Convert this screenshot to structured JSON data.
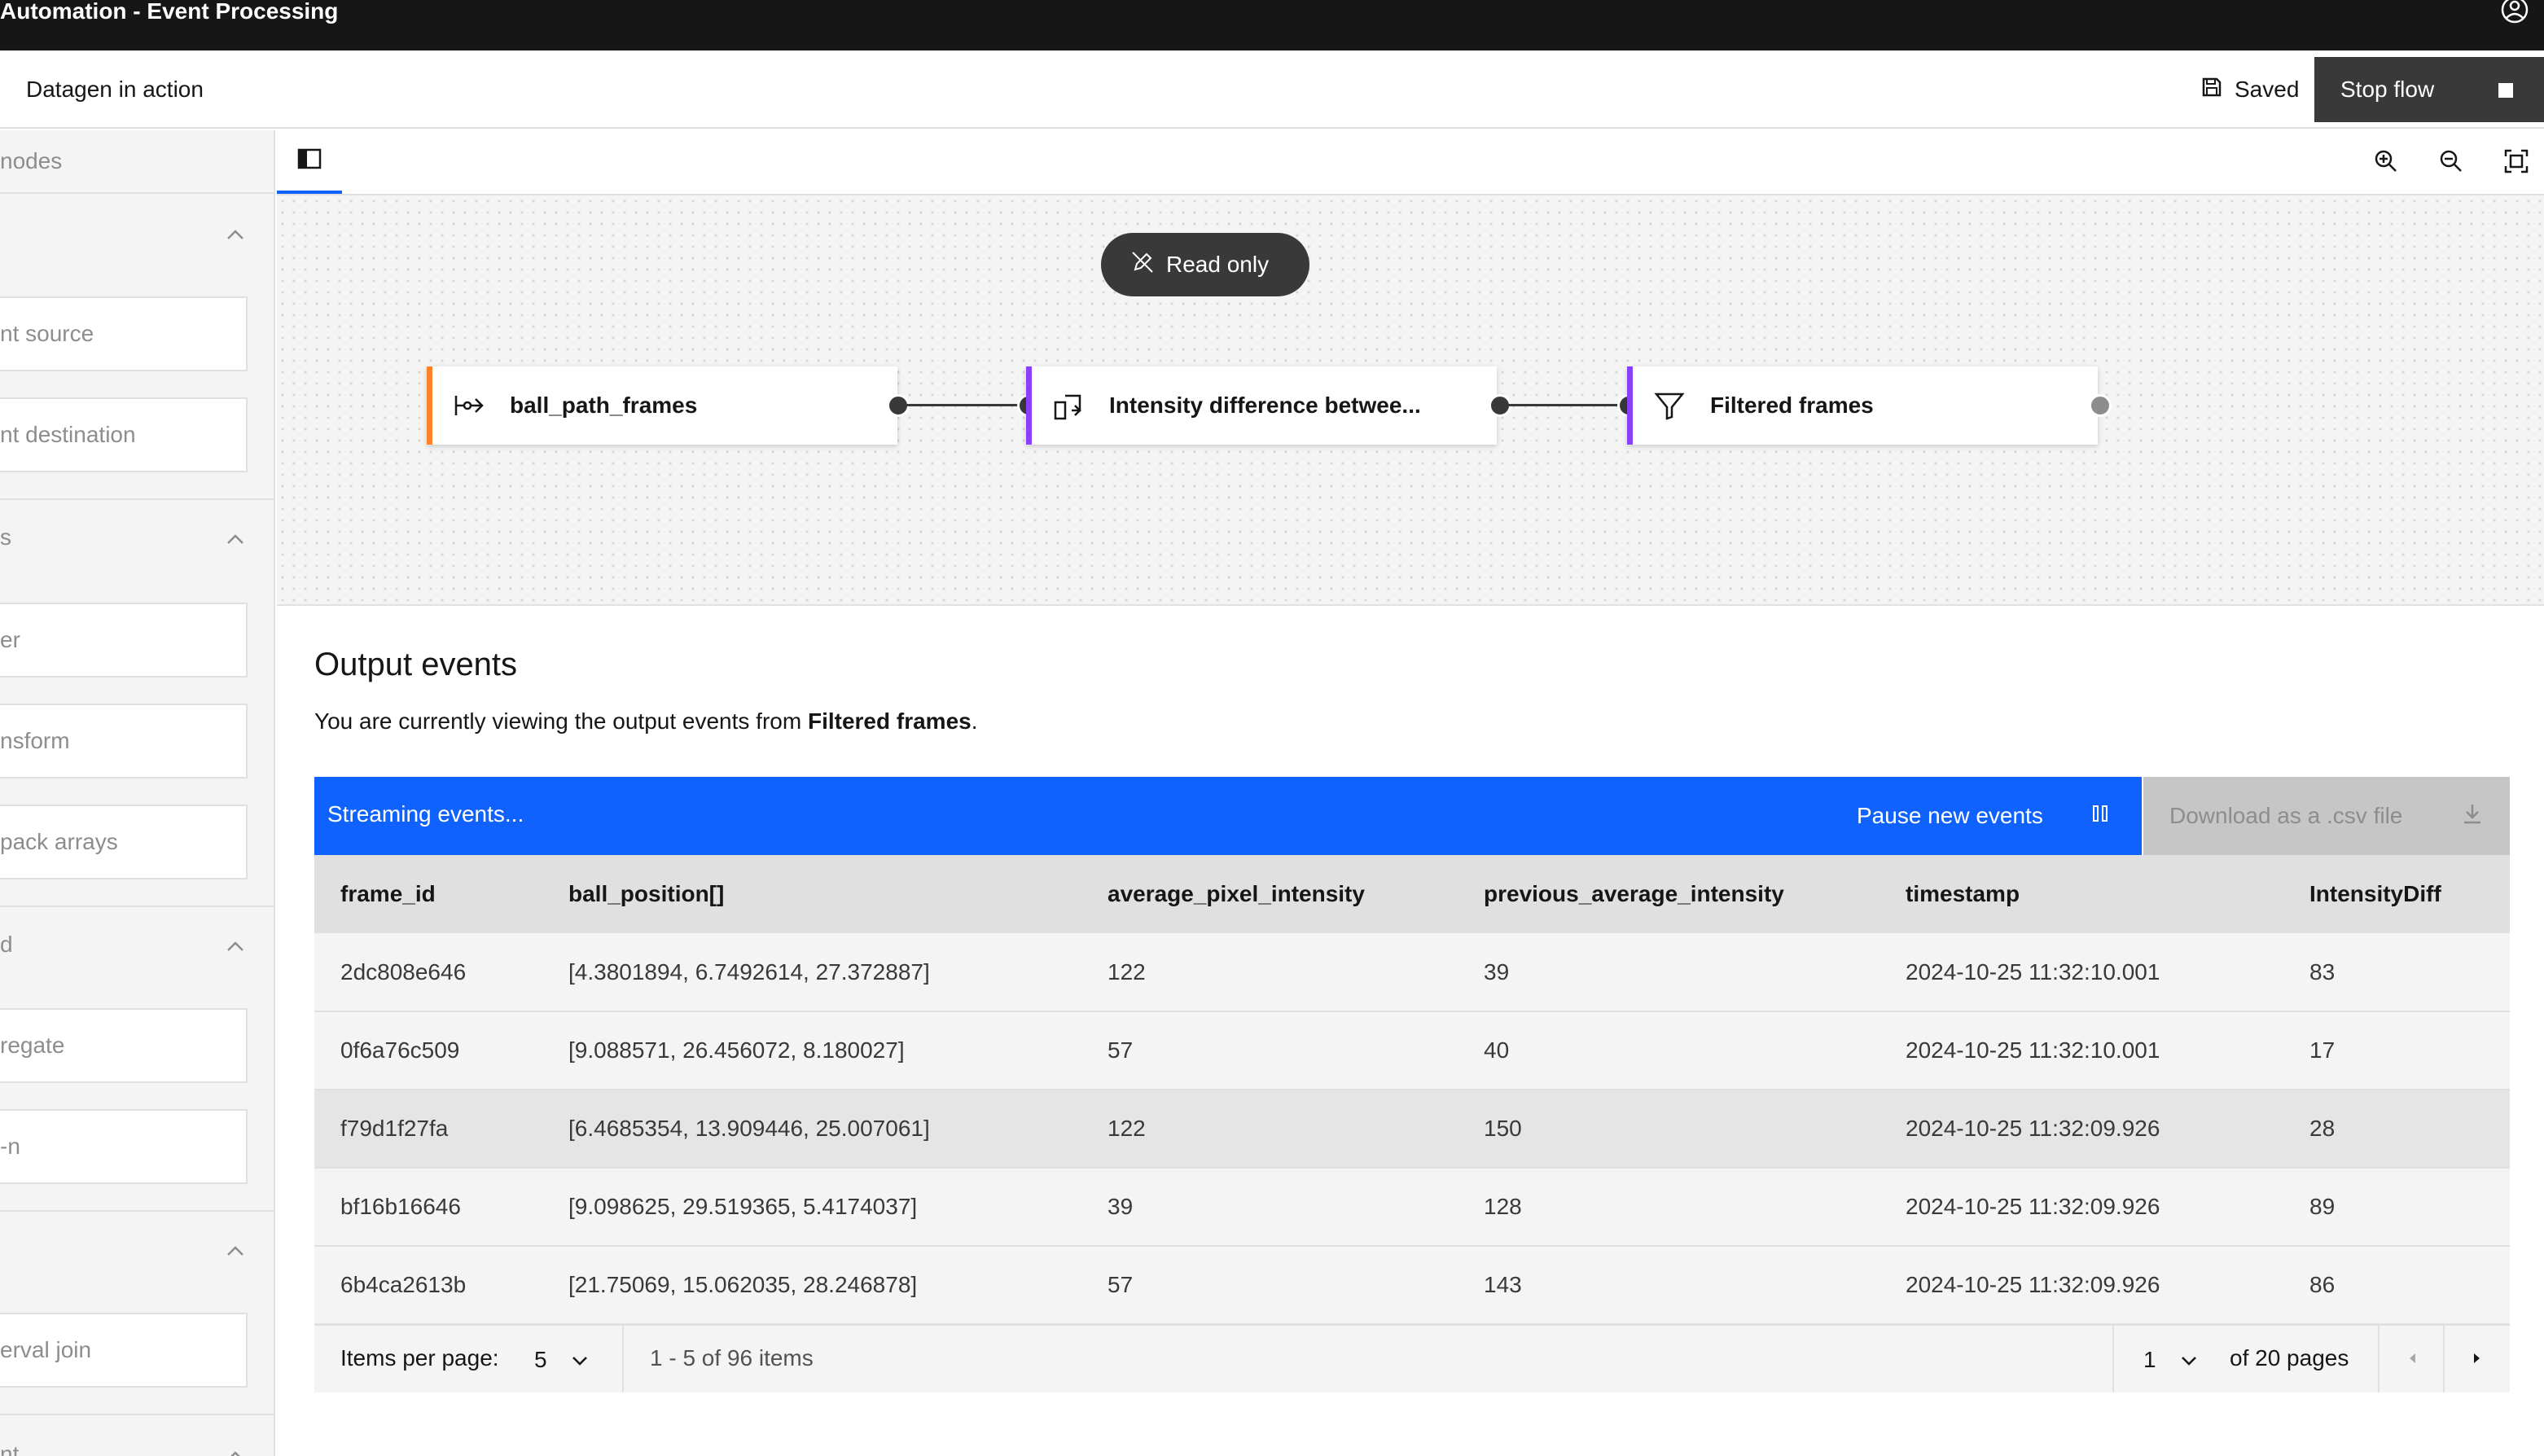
{
  "header": {
    "app_title": "Automation - Event Processing",
    "user_icon": "user-avatar-icon"
  },
  "flow": {
    "name": "Datagen in action",
    "saved_label": "Saved",
    "stop_label": "Stop flow"
  },
  "sidebar": {
    "search_placeholder": "nodes",
    "groups": [
      {
        "label": "",
        "items": [
          "nt source",
          "nt destination"
        ]
      },
      {
        "label": "s",
        "items": [
          "er",
          "nsform",
          "pack arrays"
        ]
      },
      {
        "label": "d",
        "items": [
          "regate",
          "-n"
        ]
      },
      {
        "label": "",
        "items": [
          "erval join"
        ]
      },
      {
        "label": "nt",
        "items": []
      }
    ]
  },
  "canvas": {
    "readonly_label": "Read only",
    "nodes": [
      {
        "label": "ball_path_frames",
        "accent": "#ff832b",
        "icon": "event-source-icon"
      },
      {
        "label": "Intensity difference betwee...",
        "accent": "#8a3ffc",
        "icon": "transform-icon"
      },
      {
        "label": "Filtered frames",
        "accent": "#8a3ffc",
        "icon": "filter-icon"
      }
    ]
  },
  "output": {
    "title": "Output events",
    "desc_prefix": "You are currently viewing the output events from ",
    "desc_node": "Filtered frames",
    "desc_suffix": ".",
    "streaming_label": "Streaming events...",
    "pause_label": "Pause new events",
    "download_label": "Download as a .csv file",
    "columns": [
      "frame_id",
      "ball_position[]",
      "average_pixel_intensity",
      "previous_average_intensity",
      "timestamp",
      "IntensityDiff"
    ],
    "rows": [
      [
        "2dc808e646",
        "[4.3801894, 6.7492614, 27.372887]",
        "122",
        "39",
        "2024-10-25 11:32:10.001",
        "83"
      ],
      [
        "0f6a76c509",
        "[9.088571, 26.456072, 8.180027]",
        "57",
        "40",
        "2024-10-25 11:32:10.001",
        "17"
      ],
      [
        "f79d1f27fa",
        "[6.4685354, 13.909446, 25.007061]",
        "122",
        "150",
        "2024-10-25 11:32:09.926",
        "28"
      ],
      [
        "bf16b16646",
        "[9.098625, 29.519365, 5.4174037]",
        "39",
        "128",
        "2024-10-25 11:32:09.926",
        "89"
      ],
      [
        "6b4ca2613b",
        "[21.75069, 15.062035, 28.246878]",
        "57",
        "143",
        "2024-10-25 11:32:09.926",
        "86"
      ]
    ]
  },
  "pagination": {
    "items_per_page_label": "Items per page:",
    "items_per_page": "5",
    "range": "1 - 5 of 96 items",
    "page": "1",
    "of_pages": "of 20 pages"
  },
  "colors": {
    "header_bg": "#161616",
    "primary_blue": "#0f62fe",
    "source_accent": "#ff832b",
    "processor_accent": "#8a3ffc"
  }
}
